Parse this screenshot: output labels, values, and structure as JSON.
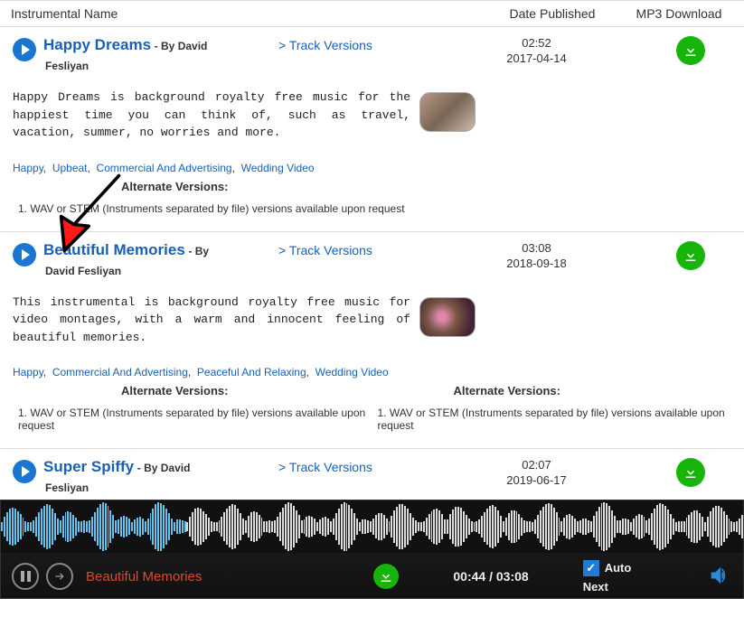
{
  "headers": {
    "name": "Instrumental Name",
    "date": "Date Published",
    "dl": "MP3 Download"
  },
  "tracks": [
    {
      "title": "Happy Dreams",
      "by_prefix": "- By ",
      "author_inline": "David",
      "author_line": "Fesliyan",
      "versions": "> Track Versions",
      "duration": "02:52",
      "published": "2017-04-14",
      "description": "Happy Dreams is background royalty free music for the happiest time you can think of, such as travel, vacation, summer, no worries and more.",
      "tag1": "Happy",
      "tag2": "Upbeat",
      "tag3": "Commercial And Advertising",
      "tag4": "Wedding Video",
      "alt_title": "Alternate Versions:",
      "alt_item": "1. WAV or STEM (Instruments separated by file) versions available upon request"
    },
    {
      "title": "Beautiful Memories",
      "by_prefix": "- By",
      "author_inline": "",
      "author_line": "David Fesliyan",
      "versions": "> Track Versions",
      "duration": "03:08",
      "published": "2018-09-18",
      "description": "This instrumental is background royalty free music for video montages, with a warm and innocent feeling of beautiful memories.",
      "tag1": "Happy",
      "tag2": "Commercial And Advertising",
      "tag3": "Peaceful And Relaxing",
      "tag4": "Wedding Video",
      "alt_title": "Alternate Versions:",
      "alt_item": "1. WAV or STEM (Instruments separated by file) versions available upon request",
      "alt_title2": "Alternate Versions:",
      "alt_item2": "1. WAV or STEM (Instruments separated by file) versions available upon request"
    },
    {
      "title": "Super Spiffy",
      "by_prefix": "- By ",
      "author_inline": "David",
      "author_line": "Fesliyan",
      "versions": "> Track Versions",
      "duration": "02:07",
      "published": "2019-06-17",
      "description": ""
    }
  ],
  "player": {
    "now": "Beautiful Memories",
    "time": "00:44 / 03:08",
    "auto": "Auto",
    "next": "Next"
  }
}
